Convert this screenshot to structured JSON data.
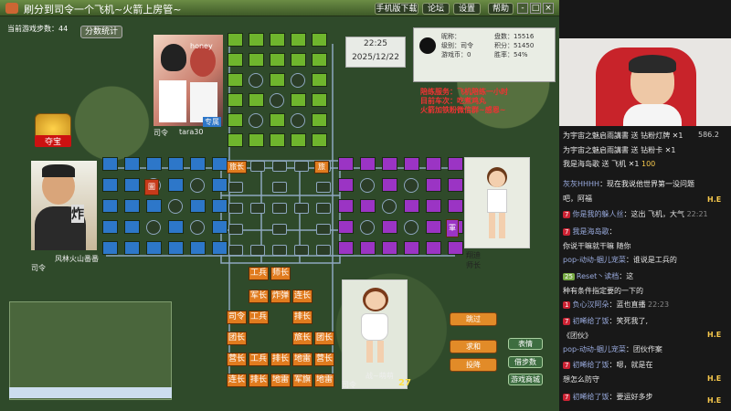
{
  "window": {
    "title": "刷分到司令一个飞机~火箭上房管~",
    "toolbar": [
      "手机版下载",
      "论坛",
      "设置",
      "帮助"
    ],
    "controls": [
      "-",
      "□",
      "×"
    ]
  },
  "game": {
    "steps_label": "当前游戏步数：44",
    "stats_button": "分数统计",
    "treasure_label": "夺宝",
    "clock_time": "22:25",
    "clock_date": "2025/12/22",
    "info": {
      "nickname_label": "昵称：",
      "level_label": "级别：",
      "level_value": "司令",
      "currency_label": "游戏币：",
      "currency_value": "0",
      "games_label": "盘数：",
      "games_value": "15516",
      "score_label": "积分：",
      "score_value": "51450",
      "winrate_label": "胜率：",
      "winrate_value": "54%"
    },
    "notice": [
      "陪练服务：飞机陪练一小时",
      "目前车次：吃煮鸡丸",
      "火箭加铁粉微信群~感恩~"
    ],
    "players": {
      "top": {
        "rank": "司令",
        "name": "tara30",
        "role": "专属"
      },
      "left": {
        "rank": "司令",
        "name": "风林火山番番"
      },
      "right": {
        "rank": "师长",
        "name": "翔迪"
      },
      "bottom": {
        "rank": "司令",
        "name": "战~萌萌",
        "count": "27"
      }
    },
    "board_tags": {
      "left_camp": "旅长",
      "right_camp": "旅",
      "left_flag": "圖",
      "right_vertical": "軍"
    },
    "my_pieces": [
      [
        "工兵",
        "师长",
        "",
        ""
      ],
      [
        "军长",
        "炸弹",
        "连长",
        ""
      ],
      [
        "司令",
        "工兵",
        "",
        "排长"
      ],
      [
        "团长",
        "",
        "旅长",
        "团长"
      ],
      [
        "营长",
        "工兵",
        "排长",
        "地雷",
        "营长"
      ],
      [
        "连长",
        "排长",
        "地雷",
        "军旗",
        "地雷"
      ]
    ],
    "buttons": {
      "skip": "跳过",
      "draw": "求和",
      "surrender": "投降",
      "emote": "表情",
      "borrow": "借步数",
      "shop": "游戏商城"
    }
  },
  "stream": {
    "gift_header": [
      "为宇宙之魅启雨講書 送 钻粉灯牌 ✕1",
      "为宇宙之魅启雨講書 送 钻粉卡 ✕1"
    ],
    "viewer_count": "586.2",
    "gift_line3": {
      "user": "我是海岛歌",
      "text": "送 飞机",
      "count": "✕1",
      "score": "100"
    },
    "messages": [
      {
        "user": "灰灰HHHH",
        "text": "：现在我说他世界第一没问题",
        "text2": "吧，阿福"
      },
      {
        "badge": "7",
        "user": "你是我的躲人丝",
        "text": "：这出 飞机，大气",
        "time": "22:21"
      },
      {
        "badge": "7",
        "user": "我是海岛歌",
        "text": "：",
        "text2": "你说干嘛就干嘛 随你"
      },
      {
        "user": "pop-动动-蝈儿宠菜",
        "text": "：谁说是工兵的"
      },
      {
        "badge": "25",
        "user": "Reset丶读档",
        "text": "：这",
        "text2": "种有条件指定要的一下的"
      },
      {
        "badge": "1",
        "user": "负心汉阿朵",
        "text": "：蓝也直播",
        "time": "22:23"
      },
      {
        "badge": "7",
        "user": "初晞给了饭",
        "text": "：笑死我了,",
        "text2": "《团伙》"
      },
      {
        "user": "pop-动动-蝈儿宠菜",
        "text": "：团伙作案"
      },
      {
        "badge": "7",
        "user": "初晞给了饭",
        "text": "：嗯，就是在",
        "text2": "想怎么防守"
      },
      {
        "badge": "7",
        "user": "初晞给了饭",
        "text": "：要运好多步"
      }
    ],
    "he_tag": "H.E"
  },
  "colors": {
    "orange": "#e07b1e",
    "green": "#6fb52d",
    "blue": "#2d77c9",
    "purple": "#9b34c4"
  }
}
